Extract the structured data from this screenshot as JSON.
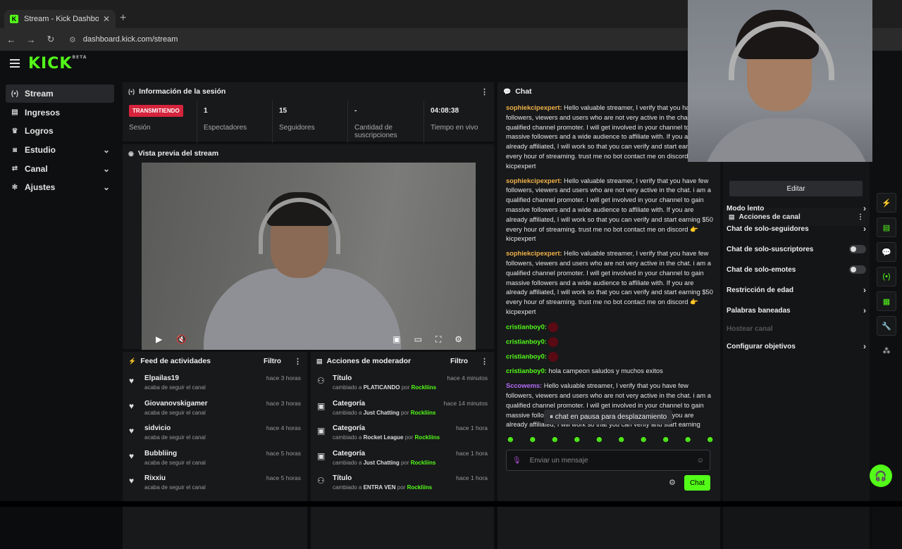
{
  "browser": {
    "tab_title": "Stream - Kick Dashboard",
    "tab_close": "✕",
    "new_tab": "+",
    "url": "dashboard.kick.com/stream"
  },
  "brand": {
    "logo": "KICK",
    "tag": "BETA",
    "accent": "#53fc18"
  },
  "sidebar": {
    "items": [
      {
        "label": "Stream",
        "icon": "broadcast-icon",
        "glyph": "(•)",
        "active": true,
        "expand": ""
      },
      {
        "label": "Ingresos",
        "icon": "revenue-icon",
        "glyph": "▤",
        "active": false,
        "expand": ""
      },
      {
        "label": "Logros",
        "icon": "trophy-icon",
        "glyph": "♛",
        "active": false,
        "expand": ""
      },
      {
        "label": "Estudio",
        "icon": "studio-icon",
        "glyph": "◙",
        "active": false,
        "expand": "⌄"
      },
      {
        "label": "Canal",
        "icon": "channel-icon",
        "glyph": "⇄",
        "active": false,
        "expand": "⌄"
      },
      {
        "label": "Ajustes",
        "icon": "settings-icon",
        "glyph": "✻",
        "active": false,
        "expand": "⌄"
      }
    ]
  },
  "session": {
    "title": "Información de la sesión",
    "status_badge": "TRANSMITIENDO",
    "status_label": "Sesión",
    "viewers_value": "1",
    "viewers_label": "Espectadores",
    "followers_value": "15",
    "followers_label": "Seguidores",
    "subs_value": "-",
    "subs_label": "Cantidad de suscripciones",
    "uptime_value": "04:08:38",
    "uptime_label": "Tiempo en vivo"
  },
  "preview": {
    "title": "Vista previa del stream"
  },
  "feed": {
    "title": "Feed de actividades",
    "filter": "Filtro",
    "items": [
      {
        "name": "Elpailas19",
        "sub": "acaba de seguir el canal",
        "time": "hace 3 horas"
      },
      {
        "name": "Giovanovskigamer",
        "sub": "acaba de seguir el canal",
        "time": "hace 3 horas"
      },
      {
        "name": "sidvicio",
        "sub": "acaba de seguir el canal",
        "time": "hace 4 horas"
      },
      {
        "name": "Bubbliing",
        "sub": "acaba de seguir el canal",
        "time": "hace 5 horas"
      },
      {
        "name": "Rixxiu",
        "sub": "acaba de seguir el canal",
        "time": "hace 5 horas"
      }
    ]
  },
  "mod": {
    "title": "Acciones de moderador",
    "filter": "Filtro",
    "changed_to": "cambiado a",
    "by": "por",
    "items": [
      {
        "name": "Título",
        "value": "PLATICANDO",
        "who": "Rockliins",
        "time": "hace 4 minutos"
      },
      {
        "name": "Categoría",
        "value": "Just Chatting",
        "who": "Rockliins",
        "time": "hace 14 minutos"
      },
      {
        "name": "Categoría",
        "value": "Rocket League",
        "who": "Rockliins",
        "time": "hace 1 hora"
      },
      {
        "name": "Categoría",
        "value": "Just Chatting",
        "who": "Rockliins",
        "time": "hace 1 hora"
      },
      {
        "name": "Título",
        "value": "ENTRA VEN",
        "who": "Rockliins",
        "time": "hace 1 hora"
      }
    ]
  },
  "chat": {
    "title": "Chat",
    "messages": [
      {
        "user": "sophiekcipexpert:",
        "color": "#f0b24a",
        "text": "Hello valuable streamer, I verify that you have few followers, viewers and users who are not very active in the chat. i am a qualified channel promoter. I will get involved in your channel to gain massive followers and a wide audience to affiliate with. If you are already affiliated, I will work so that you can verify and start earning $50 every hour of streaming. trust me no bot contact me on discord 👉 kicpexpert",
        "emote": false
      },
      {
        "user": "sophiekcipexpert:",
        "color": "#f0b24a",
        "text": "Hello valuable streamer, I verify that you have few followers, viewers and users who are not very active in the chat. i am a qualified channel promoter. I will get involved in your channel to gain massive followers and a wide audience to affiliate with. If you are already affiliated, I will work so that you can verify and start earning $50 every hour of streaming. trust me no bot contact me on discord 👉 kicpexpert",
        "emote": false
      },
      {
        "user": "sophiekcipexpert:",
        "color": "#f0b24a",
        "text": "Hello valuable streamer, I verify that you have few followers, viewers and users who are not very active in the chat. i am a qualified channel promoter. I will get involved in your channel to gain massive followers and a wide audience to affiliate with. If you are already affiliated, I will work so that you can verify and start earning $50 every hour of streaming. trust me no bot contact me on discord 👉 kicpexpert",
        "emote": false
      },
      {
        "user": "cristianboy0:",
        "color": "#53fc18",
        "text": "",
        "emote": true
      },
      {
        "user": "cristianboy0:",
        "color": "#53fc18",
        "text": "",
        "emote": true
      },
      {
        "user": "cristianboy0:",
        "color": "#53fc18",
        "text": "",
        "emote": true
      },
      {
        "user": "cristianboy0:",
        "color": "#53fc18",
        "text": "hola campeon saludos y muchos exitos",
        "emote": false
      },
      {
        "user": "Sccowems:",
        "color": "#b26cf5",
        "text": "Hello valuable streamer, I verify that you have few followers, viewers and users who are not very active in the chat. i am a qualified channel promoter. I will get involved in your channel to gain massive followers and a wide audience to affiliate with. If you are already affiliated, I will work so that you can verify and start earning",
        "emote": false
      }
    ],
    "paused": "chat en pausa para desplazamiento",
    "placeholder": "Enviar un mensaje",
    "send": "Chat"
  },
  "right_panel": {
    "edit": "Editar",
    "actions_title": "Acciones de canal",
    "options": [
      {
        "label": "Modo lento",
        "kind": "arrow"
      },
      {
        "label": "Chat de solo-seguidores",
        "kind": "arrow"
      },
      {
        "label": "Chat de solo-suscriptores",
        "kind": "toggle"
      },
      {
        "label": "Chat de solo-emotes",
        "kind": "toggle"
      },
      {
        "label": "Restricción de edad",
        "kind": "arrow"
      },
      {
        "label": "Palabras baneadas",
        "kind": "arrow"
      },
      {
        "label": "Hostear canal",
        "kind": "disabled"
      },
      {
        "label": "Configurar objetivos",
        "kind": "arrow"
      }
    ]
  }
}
